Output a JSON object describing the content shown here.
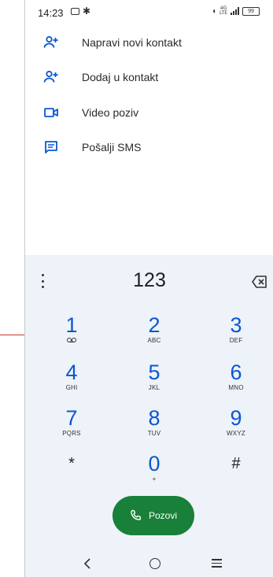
{
  "status_bar": {
    "time": "14:23",
    "network_top": "4G",
    "network_bottom": "LTE",
    "battery": "99"
  },
  "menu": {
    "items": [
      {
        "label": "Napravi novi kontakt",
        "icon": "add-person-icon"
      },
      {
        "label": "Dodaj u kontakt",
        "icon": "add-person-icon"
      },
      {
        "label": "Video poziv",
        "icon": "video-camera-icon"
      },
      {
        "label": "Pošalji SMS",
        "icon": "message-icon"
      }
    ]
  },
  "dialer": {
    "number": "123",
    "keys": [
      {
        "digit": "1",
        "letters": ""
      },
      {
        "digit": "2",
        "letters": "ABC"
      },
      {
        "digit": "3",
        "letters": "DEF"
      },
      {
        "digit": "4",
        "letters": "GHI"
      },
      {
        "digit": "5",
        "letters": "JKL"
      },
      {
        "digit": "6",
        "letters": "MNO"
      },
      {
        "digit": "7",
        "letters": "PQRS"
      },
      {
        "digit": "8",
        "letters": "TUV"
      },
      {
        "digit": "9",
        "letters": "WXYZ"
      },
      {
        "digit": "*",
        "letters": ""
      },
      {
        "digit": "0",
        "letters": "+"
      },
      {
        "digit": "#",
        "letters": ""
      }
    ],
    "call_label": "Pozovi"
  },
  "colors": {
    "accent": "#0b57d0",
    "call_button": "#188038",
    "sheet_bg": "#eef2f9",
    "callout": "#c0392b"
  }
}
